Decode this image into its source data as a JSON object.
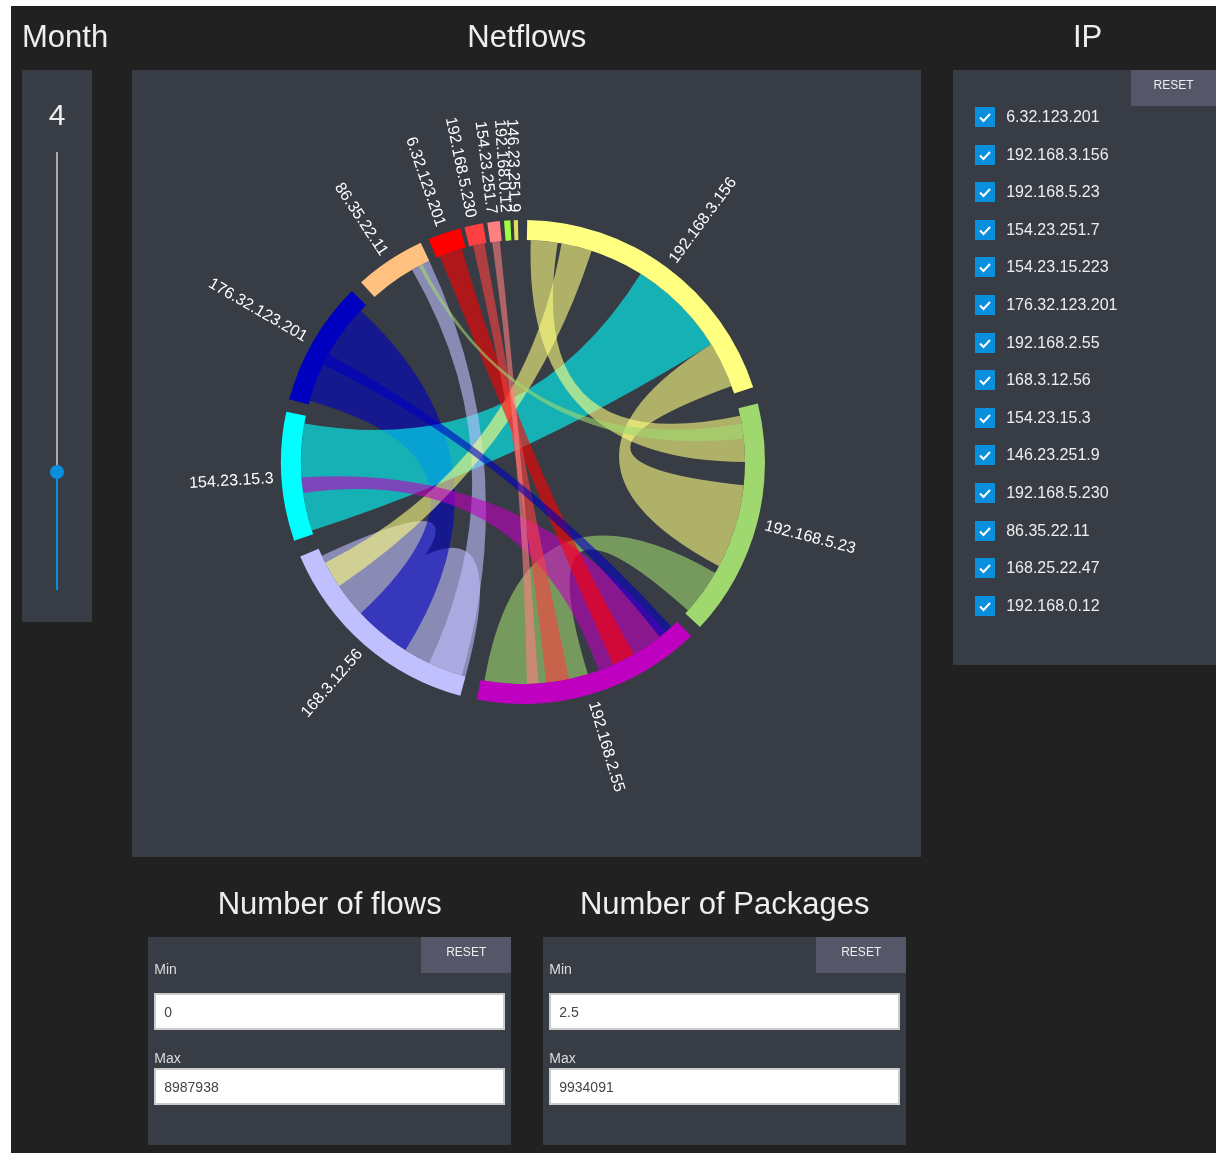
{
  "month": {
    "title": "Month",
    "value": "4",
    "level": 0.27
  },
  "netflows": {
    "title": "Netflows",
    "groups": [
      {
        "label": "192.168.3.156",
        "color": "#ffff80"
      },
      {
        "label": "192.168.5.23",
        "color": "#a0d870"
      },
      {
        "label": "192.168.2.55",
        "color": "#c000c0"
      },
      {
        "label": "168.3.12.56",
        "color": "#c0c0ff"
      },
      {
        "label": "154.23.15.3",
        "color": "#00ffff"
      },
      {
        "label": "176.32.123.201",
        "color": "#0000c0"
      },
      {
        "label": "86.35.22.11",
        "color": "#ffc080"
      },
      {
        "label": "6.32.123.201",
        "color": "#ff0000"
      },
      {
        "label": "192.168.5.230",
        "color": "#ff4040"
      },
      {
        "label": "154.23.251.7",
        "color": "#ff8080"
      },
      {
        "label": "192.168.0.12",
        "color": "#a0ff40"
      },
      {
        "label": "146.23.251.9",
        "color": "#e0e060"
      }
    ]
  },
  "ip": {
    "title": "IP",
    "reset": "RESET",
    "items": [
      {
        "label": "6.32.123.201",
        "checked": true
      },
      {
        "label": "192.168.3.156",
        "checked": true
      },
      {
        "label": "192.168.5.23",
        "checked": true
      },
      {
        "label": "154.23.251.7",
        "checked": true
      },
      {
        "label": "154.23.15.223",
        "checked": true
      },
      {
        "label": "176.32.123.201",
        "checked": true
      },
      {
        "label": "192.168.2.55",
        "checked": true
      },
      {
        "label": "168.3.12.56",
        "checked": true
      },
      {
        "label": "154.23.15.3",
        "checked": true
      },
      {
        "label": "146.23.251.9",
        "checked": true
      },
      {
        "label": "192.168.5.230",
        "checked": true
      },
      {
        "label": "86.35.22.11",
        "checked": true
      },
      {
        "label": "168.25.22.47",
        "checked": true
      },
      {
        "label": "192.168.0.12",
        "checked": true
      }
    ]
  },
  "filters": [
    {
      "title": "Number of flows",
      "reset": "RESET",
      "min_label": "Min",
      "min": "0",
      "max_label": "Max",
      "max": "8987938"
    },
    {
      "title": "Number of Packages",
      "reset": "RESET",
      "min_label": "Min",
      "min": "2.5",
      "max_label": "Max",
      "max": "9934091"
    }
  ]
}
